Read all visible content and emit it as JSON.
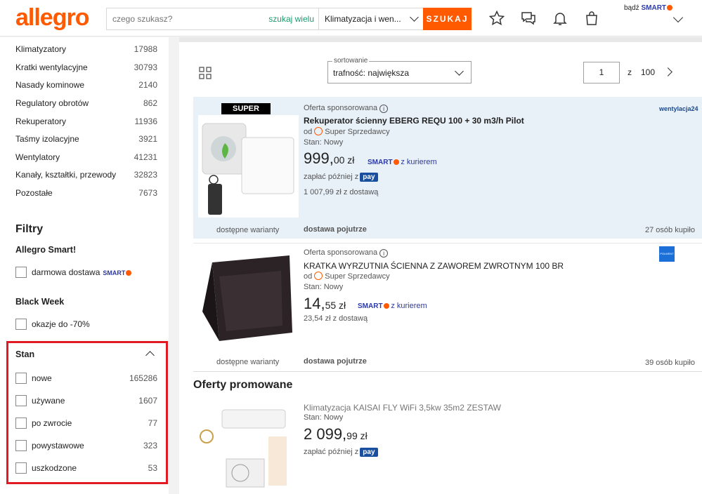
{
  "header": {
    "logo": "allegro",
    "search_placeholder": "czego szukasz?",
    "search_many": "szukaj wielu",
    "category": "Klimatyzacja i wen...",
    "search_button": "SZUKAJ",
    "smart_prefix": "bądź",
    "smart_label": "SMART"
  },
  "sidebar": {
    "categories": [
      {
        "label": "Klimatyzatory",
        "count": "17988"
      },
      {
        "label": "Kratki wentylacyjne",
        "count": "30793"
      },
      {
        "label": "Nasady kominowe",
        "count": "2140"
      },
      {
        "label": "Regulatory obrotów",
        "count": "862"
      },
      {
        "label": "Rekuperatory",
        "count": "11936"
      },
      {
        "label": "Taśmy izolacyjne",
        "count": "3921"
      },
      {
        "label": "Wentylatory",
        "count": "41231"
      },
      {
        "label": "Kanały, kształtki, przewody",
        "count": "32823"
      },
      {
        "label": "Pozostałe",
        "count": "7673"
      }
    ],
    "filters_title": "Filtry",
    "smart_head": "Allegro Smart!",
    "smart_option": "darmowa dostawa",
    "smart_badge": "SMART",
    "black_week_head": "Black Week",
    "black_week_option": "okazje do -70%",
    "stan_head": "Stan",
    "stan_options": [
      {
        "label": "nowe",
        "count": "165286"
      },
      {
        "label": "używane",
        "count": "1607"
      },
      {
        "label": "po zwrocie",
        "count": "77"
      },
      {
        "label": "powystawowe",
        "count": "323"
      },
      {
        "label": "uszkodzone",
        "count": "53"
      }
    ]
  },
  "toolbar": {
    "sort_legend": "sortowanie",
    "sort_value": "trafność: największa",
    "page_current": "1",
    "page_of": "z",
    "page_total": "100"
  },
  "offers": [
    {
      "badge": "SUPER CENA",
      "sponsored": "Oferta sponsorowana",
      "title": "Rekuperator ścienny EBERG REQU 100 + 30 m3/h Pilot",
      "seller_prefix": "od",
      "seller": "Super Sprzedawcy",
      "stan": "Stan: Nowy",
      "price_main": "999,",
      "price_cents": "00 zł",
      "smart": "SMART",
      "courier": "z kurierem",
      "pay_later": "zapłać później z",
      "pay_badge": "pay",
      "delivery_total": "1 007,99 zł z dostawą",
      "variants": "dostępne warianty",
      "shipping": "dostawa pojutrze",
      "sold": "27 osób kupiło",
      "brand": "wentylacja24"
    },
    {
      "sponsored": "Oferta sponsorowana",
      "title": "KRATKA WYRZUTNIA ŚCIENNA Z ZAWOREM ZWROTNYM 100 BR",
      "seller_prefix": "od",
      "seller": "Super Sprzedawcy",
      "stan": "Stan: Nowy",
      "price_main": "14,",
      "price_cents": "55 zł",
      "smart": "SMART",
      "courier": "z kurierem",
      "delivery_total": "23,54 zł z dostawą",
      "variants": "dostępne warianty",
      "shipping": "dostawa pojutrze",
      "sold": "39 osób kupiło",
      "brand": "POLWENT"
    }
  ],
  "promo": {
    "heading": "Oferty promowane",
    "title": "Klimatyzacja KAISAI FLY WiFi 3,5kw 35m2 ZESTAW",
    "stan": "Stan: Nowy",
    "price_main": "2 099,",
    "price_cents": "99 zł",
    "pay_later": "zapłać później z",
    "pay_badge": "pay"
  },
  "colors": {
    "brand": "#ff5a00",
    "smart": "#2c3aa4",
    "highlight": "#e01b24",
    "sponsored_bg": "#e8f0f8"
  }
}
